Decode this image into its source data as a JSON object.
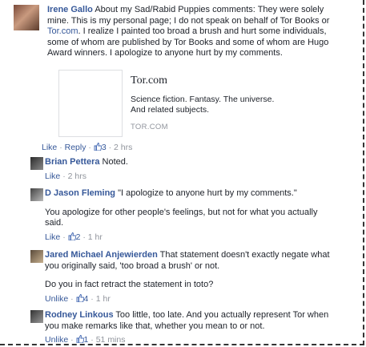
{
  "post": {
    "author": "Irene Gallo",
    "text_before_link": "About my Sad/Rabid Puppies comments: They were solely mine. This is my personal page; I do not speak on behalf of Tor Books or ",
    "link_text": "Tor.com",
    "text_after_link": ". I realize I painted too broad a brush and hurt some individuals, some of whom are published by Tor Books and some of whom are Hugo Award winners. I apologize to anyone hurt by my comments.",
    "card": {
      "title": "Tor.com",
      "description": "Science fiction. Fantasy. The universe. And related subjects.",
      "domain": "TOR.COM"
    },
    "actions": {
      "like": "Like",
      "reply": "Reply",
      "likes_count": "3",
      "time": "2 hrs",
      "sep": "·"
    }
  },
  "replies": [
    {
      "author": "Brian Pettera",
      "text": "Noted.",
      "like_label": "Like",
      "likes_count": "",
      "time": "2 hrs"
    },
    {
      "author": "D Jason Fleming",
      "text": "\"I apologize to anyone hurt by my comments.\"",
      "text2": "You apologize for other people's feelings, but not for what you actually said.",
      "like_label": "Like",
      "likes_count": "2",
      "time": "1 hr"
    },
    {
      "author": "Jared Michael Anjewierden",
      "text": "That statement doesn't exactly negate what you originally said, 'too broad a brush' or not.",
      "text2": "Do you in fact retract the statement in toto?",
      "like_label": "Unlike",
      "likes_count": "4",
      "time": "1 hr"
    },
    {
      "author": "Rodney Linkous",
      "text": "Too little, too late. And you actually represent Tor when you make remarks like that, whether you mean to or not.",
      "like_label": "Unlike",
      "likes_count": "1",
      "time": "51 mins"
    }
  ],
  "colors": {
    "link": "#365899",
    "meta": "#90949c",
    "text": "#1d2129"
  }
}
